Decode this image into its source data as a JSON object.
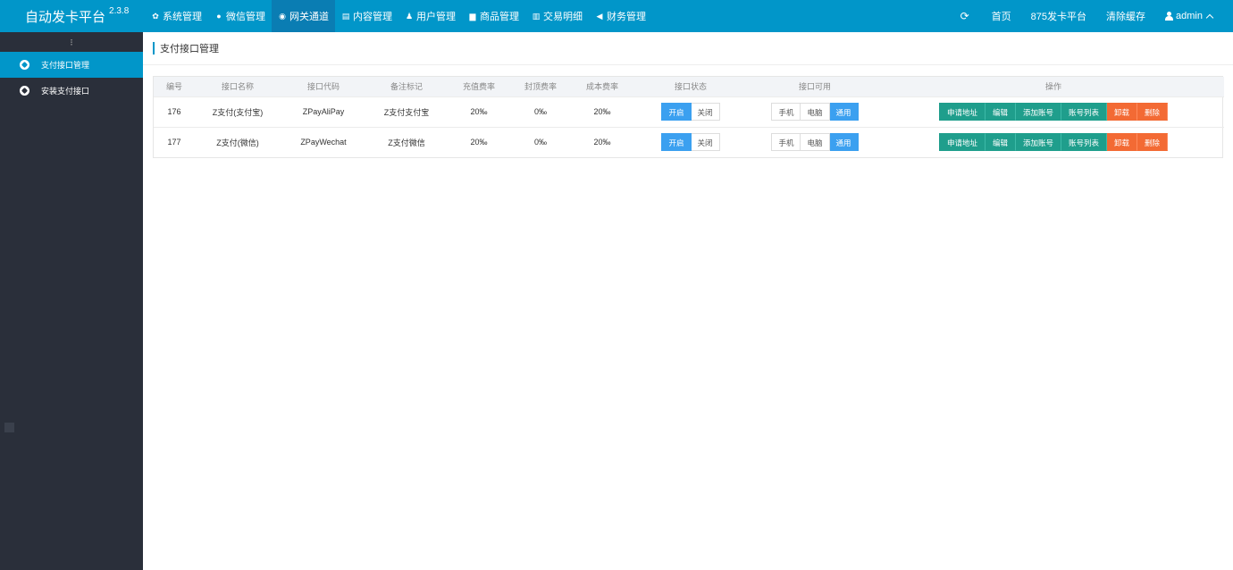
{
  "brand": {
    "name": "自动发卡平台",
    "version": "2.3.8"
  },
  "topnav": [
    {
      "label": "系统管理",
      "icon": "gear-icon",
      "glyph": "✿"
    },
    {
      "label": "微信管理",
      "icon": "wechat-icon",
      "glyph": "●"
    },
    {
      "label": "网关通道",
      "icon": "gateway-icon",
      "glyph": "◉",
      "active": true
    },
    {
      "label": "内容管理",
      "icon": "document-icon",
      "glyph": "▤"
    },
    {
      "label": "用户管理",
      "icon": "users-icon",
      "glyph": "♟"
    },
    {
      "label": "商品管理",
      "icon": "shopping-bag-icon",
      "glyph": "▆"
    },
    {
      "label": "交易明细",
      "icon": "bar-chart-icon",
      "glyph": "▥"
    },
    {
      "label": "财务管理",
      "icon": "bullhorn-icon",
      "glyph": "◀"
    }
  ],
  "topright": {
    "refresh_glyph": "⟳",
    "home": "首页",
    "platform": "875发卡平台",
    "clear_cache": "清除缓存",
    "user": "admin"
  },
  "sidebar": {
    "toggle_glyph": "⁝",
    "items": [
      {
        "label": "支付接口管理",
        "active": true
      },
      {
        "label": "安装支付接口",
        "active": false
      }
    ]
  },
  "page": {
    "title": "支付接口管理"
  },
  "table": {
    "headers": [
      "编号",
      "接口名称",
      "接口代码",
      "备注标记",
      "充值费率",
      "封顶费率",
      "成本费率",
      "接口状态",
      "接口可用",
      "操作"
    ],
    "rows": [
      {
        "id": "176",
        "name": "Z支付(支付宝)",
        "code": "ZPayAliPay",
        "remark": "Z支付支付宝",
        "recharge_rate": "20‰",
        "cap_rate": "0‰",
        "cost_rate": "20‰"
      },
      {
        "id": "177",
        "name": "Z支付(微信)",
        "code": "ZPayWechat",
        "remark": "Z支付微信",
        "recharge_rate": "20‰",
        "cap_rate": "0‰",
        "cost_rate": "20‰"
      }
    ],
    "status_buttons": {
      "on": "开启",
      "off": "关闭",
      "selected": "开启"
    },
    "availability_buttons": {
      "mobile": "手机",
      "pc": "电脑",
      "all": "通用",
      "selected": "通用"
    },
    "actions": {
      "apply": "申请地址",
      "edit": "编辑",
      "add_account": "添加账号",
      "account_list": "账号列表",
      "uninstall": "卸载",
      "delete": "删除"
    }
  },
  "colors": {
    "primary": "#0196c9",
    "sidebar": "#2a2f3a",
    "blue_btn": "#3ba0f0",
    "teal_btn": "#1f9e8c",
    "orange_btn": "#f36a34"
  }
}
